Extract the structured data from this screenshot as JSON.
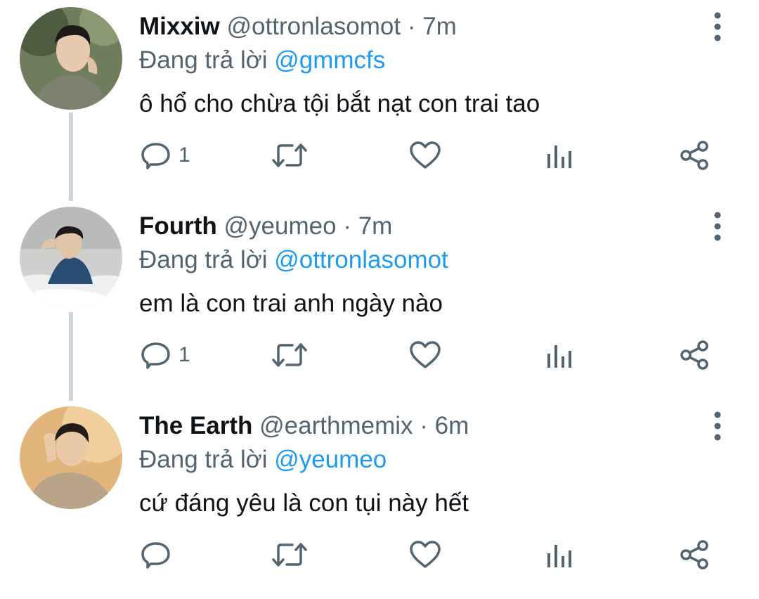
{
  "tweets": [
    {
      "name": "Mixxiw",
      "handle": "@ottronlasomot",
      "separator": "·",
      "time": "7m",
      "reply_prefix": "Đang trả lời",
      "reply_to": "@gmmcfs",
      "text": "ô hổ cho chừa tội bắt nạt con trai tao",
      "reply_count": "1",
      "avatar_tone": "#7a8a6a"
    },
    {
      "name": "Fourth",
      "handle": "@yeumeo",
      "separator": "·",
      "time": "7m",
      "reply_prefix": "Đang trả lời",
      "reply_to": "@ottronlasomot",
      "text": "em là con trai anh ngày nào",
      "reply_count": "1",
      "avatar_tone": "#c9cbcc"
    },
    {
      "name": "The Earth",
      "handle": "@earthmemix",
      "separator": "·",
      "time": "6m",
      "reply_prefix": "Đang trả lời",
      "reply_to": "@yeumeo",
      "text": "cứ đáng yêu là con tụi này hết",
      "reply_count": "",
      "avatar_tone": "#d9a66a"
    }
  ],
  "icons": {
    "reply": "reply-icon",
    "retweet": "retweet-icon",
    "like": "heart-icon",
    "views": "analytics-icon",
    "share": "share-icon",
    "more": "more-vertical-icon"
  },
  "colors": {
    "text": "#0f1419",
    "muted": "#536471",
    "link": "#1d9bf0",
    "thread_line": "#ced5db"
  }
}
